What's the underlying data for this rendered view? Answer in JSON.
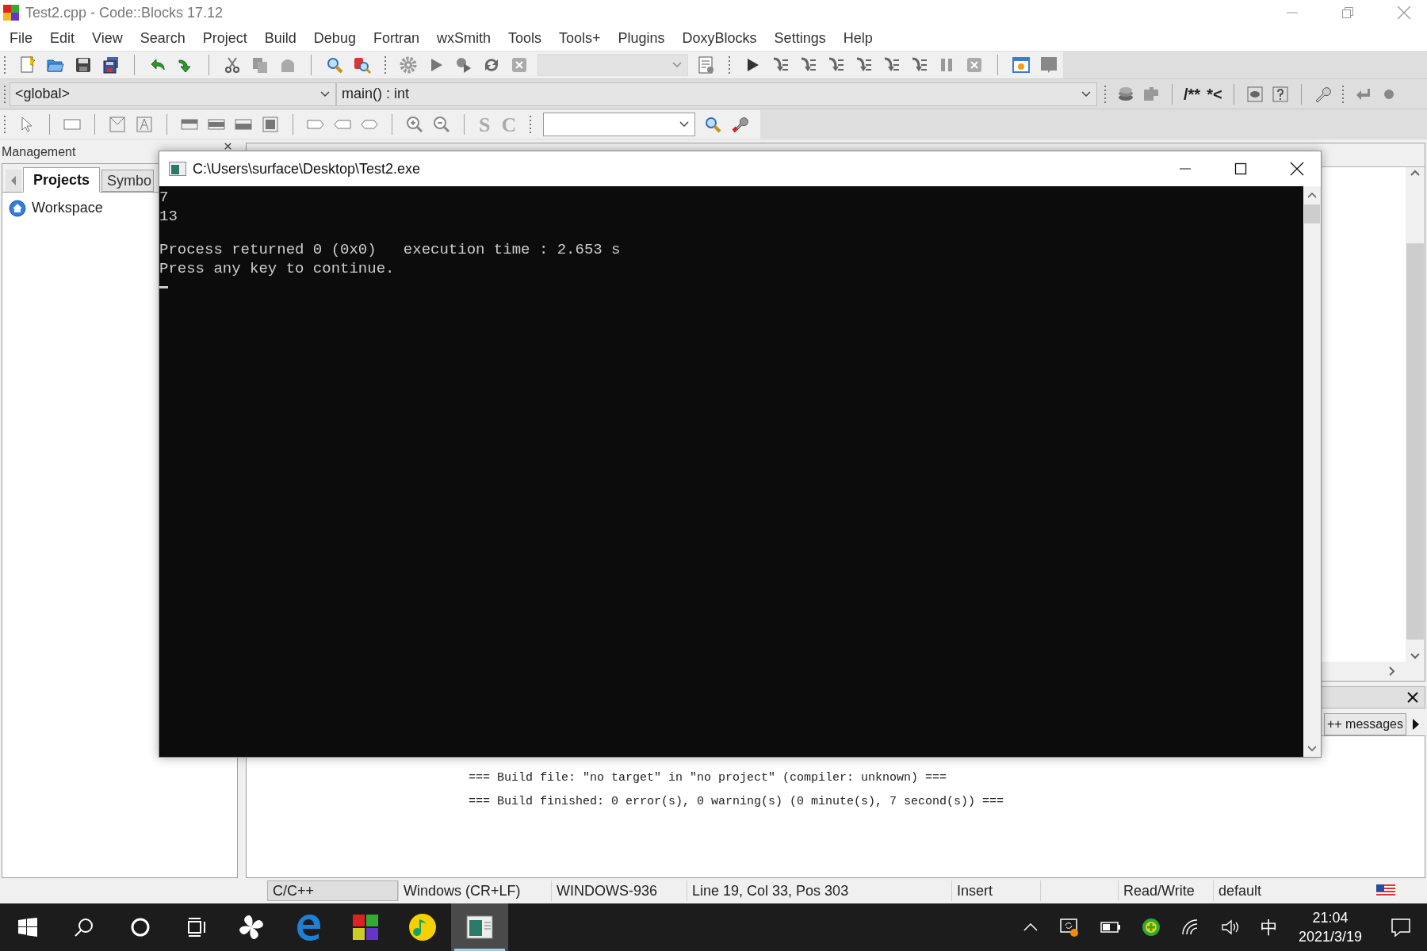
{
  "window": {
    "title": "Test2.cpp - Code::Blocks 17.12"
  },
  "menu": [
    "File",
    "Edit",
    "View",
    "Search",
    "Project",
    "Build",
    "Debug",
    "Fortran",
    "wxSmith",
    "Tools",
    "Tools+",
    "Plugins",
    "DoxyBlocks",
    "Settings",
    "Help"
  ],
  "code_bar": {
    "scope": "<global>",
    "function": "main() : int"
  },
  "doxy_buttons": [
    "/**",
    "*<"
  ],
  "designer_letters": [
    "S",
    "C"
  ],
  "management": {
    "title": "Management",
    "tabs": [
      {
        "label": "Projects",
        "selected": true
      },
      {
        "label": "Symbo",
        "selected": false
      }
    ],
    "tree": [
      {
        "label": "Workspace"
      }
    ]
  },
  "logs": {
    "tab": "++ messages",
    "lines": [
      "=== Build file: \"no target\" in \"no project\" (compiler: unknown) ===",
      "=== Build finished: 0 error(s), 0 warning(s) (0 minute(s), 7 second(s)) ==="
    ]
  },
  "console": {
    "title": "C:\\Users\\surface\\Desktop\\Test2.exe",
    "output": [
      "7",
      "13"
    ],
    "messages": [
      "Process returned 0 (0x0)   execution time : 2.653 s",
      "Press any key to continue."
    ]
  },
  "status_bar": [
    "C/C++",
    "Windows (CR+LF)",
    "WINDOWS-936",
    "Line 19, Col 33, Pos 303",
    "Insert",
    "Read/Write",
    "default"
  ],
  "taskbar": {
    "apps": [
      {
        "kind": "fan",
        "selected": false
      },
      {
        "kind": "edge",
        "selected": false
      },
      {
        "kind": "blocks",
        "selected": false
      },
      {
        "kind": "music",
        "selected": false
      },
      {
        "kind": "console",
        "selected": true
      }
    ],
    "ime": "中",
    "time": "21:04",
    "date": "2021/3/19"
  }
}
